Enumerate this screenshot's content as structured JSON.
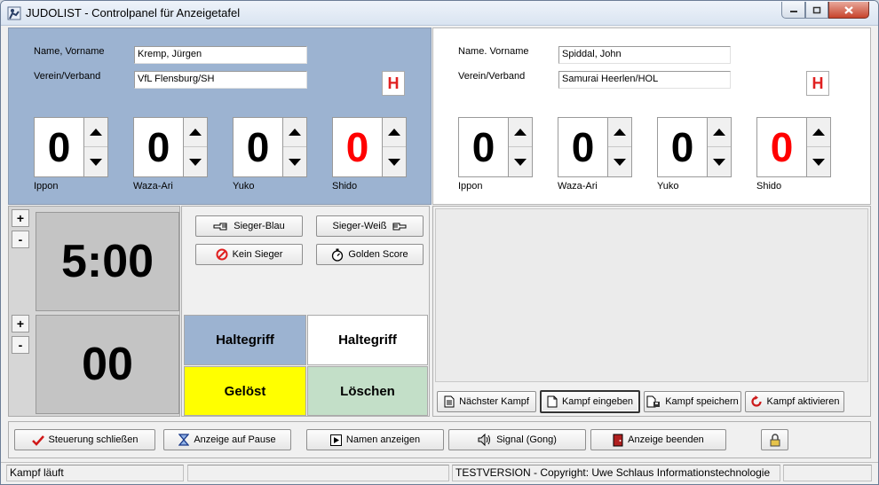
{
  "window": {
    "title": "JUDOLIST - Controlpanel für Anzeigetafel"
  },
  "blue": {
    "name_label": "Name, Vorname",
    "club_label": "Verein/Verband",
    "name_value": "Kremp, Jürgen",
    "club_value": "VfL Flensburg/SH",
    "hansoku": "H",
    "scores": [
      {
        "label": "Ippon",
        "value": "0"
      },
      {
        "label": "Waza-Ari",
        "value": "0"
      },
      {
        "label": "Yuko",
        "value": "0"
      },
      {
        "label": "Shido",
        "value": "0"
      }
    ]
  },
  "white": {
    "name_label": "Name. Vorname",
    "club_label": "Verein/Verband",
    "name_value": "Spiddal, John",
    "club_value": "Samurai Heerlen/HOL",
    "hansoku": "H",
    "scores": [
      {
        "label": "Ippon",
        "value": "0"
      },
      {
        "label": "Waza-Ari",
        "value": "0"
      },
      {
        "label": "Yuko",
        "value": "0"
      },
      {
        "label": "Shido",
        "value": "0"
      }
    ]
  },
  "timer": {
    "main": "5:00",
    "osaekomi": "00",
    "plus": "+",
    "minus": "-"
  },
  "decision": {
    "winner_blue": "Sieger-Blau",
    "winner_white": "Sieger-Weiß",
    "no_winner": "Kein Sieger",
    "golden_score": "Golden Score"
  },
  "osaekomi": {
    "haltegriff_blue": "Haltegriff",
    "haltegriff_white": "Haltegriff",
    "geloest": "Gelöst",
    "loeschen": "Löschen"
  },
  "fight": {
    "next": "Nächster Kampf",
    "enter": "Kampf eingeben",
    "save": "Kampf speichern",
    "activate": "Kampf aktivieren"
  },
  "bottom": {
    "close_control": "Steuerung schließen",
    "pause": "Anzeige auf Pause",
    "show_names": "Namen anzeigen",
    "signal": "Signal (Gong)",
    "end_display": "Anzeige beenden"
  },
  "status": {
    "left": "Kampf läuft",
    "right": "TESTVERSION - Copyright: Uwe Schlaus Informationstechnologie"
  },
  "colors": {
    "blue_panel": "#9cb3d1",
    "shido_red": "#ff0000",
    "geloest_yellow": "#ffff00",
    "loeschen_green": "#c3dfc8"
  }
}
